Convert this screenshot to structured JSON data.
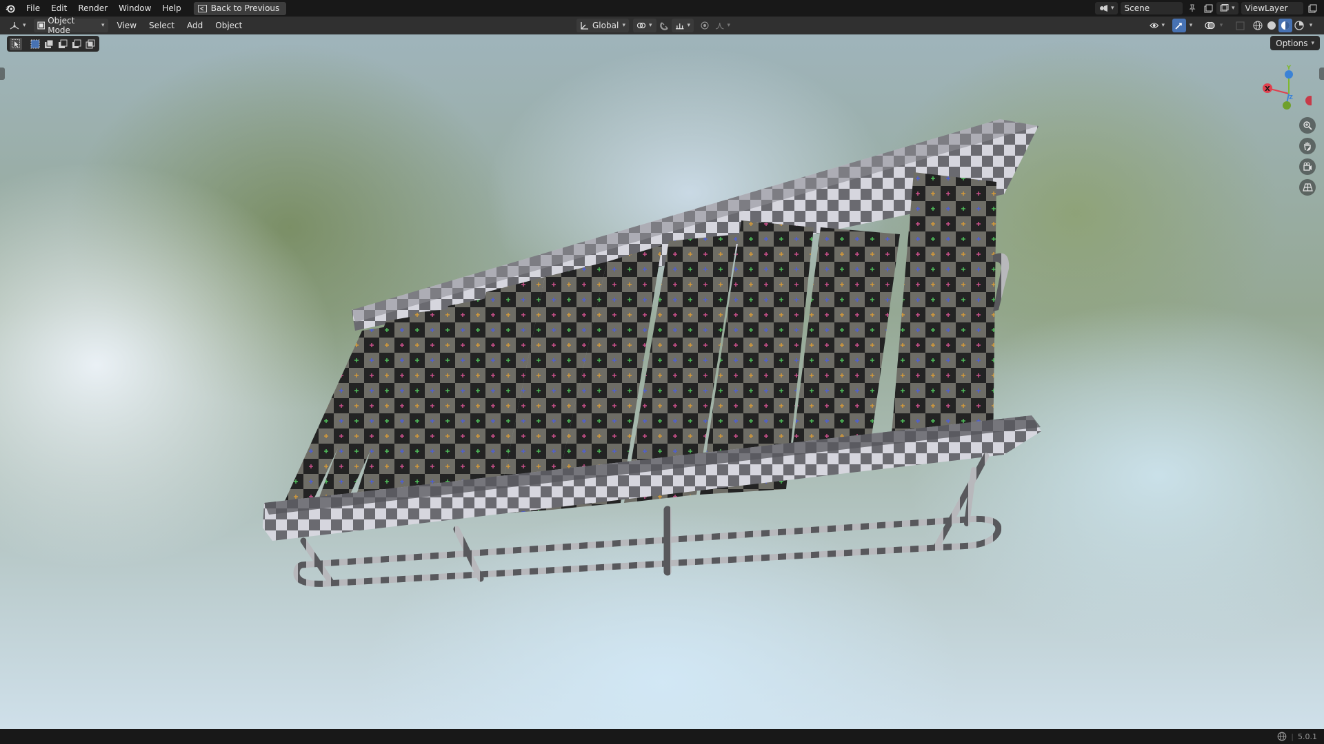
{
  "menubar": {
    "items": [
      "File",
      "Edit",
      "Render",
      "Window",
      "Help"
    ],
    "back_button": "Back to Previous",
    "scene_name": "Scene",
    "view_layer": "ViewLayer"
  },
  "viewport_header": {
    "mode": "Object Mode",
    "menus": [
      "View",
      "Select",
      "Add",
      "Object"
    ],
    "transform_orientation": "Global"
  },
  "viewport": {
    "options_label": "Options",
    "gizmo": {
      "x_label": "X",
      "y_label": "Y",
      "z_label": "Z"
    }
  },
  "statusbar": {
    "version": "5.0.1"
  },
  "colors": {
    "axis_x": "#e0404e",
    "axis_y": "#7fb830",
    "axis_z": "#3b82d6",
    "active_shading": "#4772b3"
  }
}
